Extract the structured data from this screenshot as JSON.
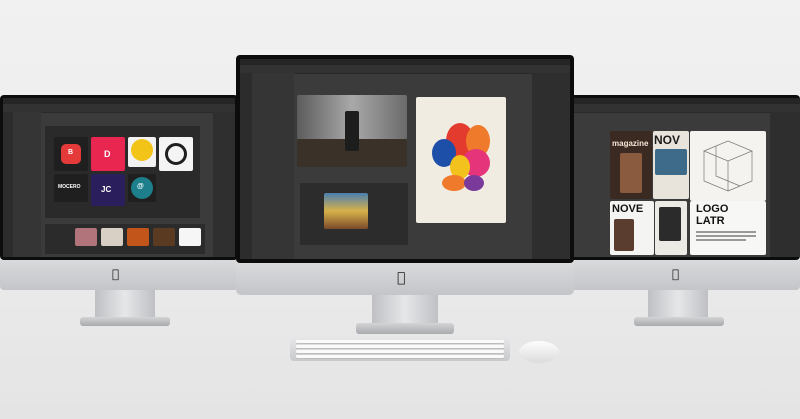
{
  "scene": {
    "description_none": "",
    "colors": {
      "background": "#ececec",
      "bezel": "#0c0c0c",
      "app_dark": "#3b3b3b",
      "aluminum": "#c8c9cc"
    }
  },
  "left_monitor": {
    "apple_logo": "",
    "tiles": [
      {
        "label": "B",
        "color": "#e53a3a"
      },
      {
        "label": "D",
        "color": "#e8264f"
      },
      {
        "label": "",
        "color": "#f2c418"
      },
      {
        "label": "",
        "color": "#f4f4f4"
      },
      {
        "label": "MOCERO",
        "color": "#1f1f1f"
      },
      {
        "label": "JC",
        "color": "#2a1f5c"
      },
      {
        "label": "@",
        "color": "#1d7f8c"
      }
    ]
  },
  "center_monitor": {
    "apple_logo": ""
  },
  "right_monitor": {
    "apple_logo": "",
    "magazine_words": [
      "magazine",
      "NOV",
      "NOVE",
      "LOGO",
      "LATR"
    ]
  },
  "keyboard": {},
  "mouse": {}
}
